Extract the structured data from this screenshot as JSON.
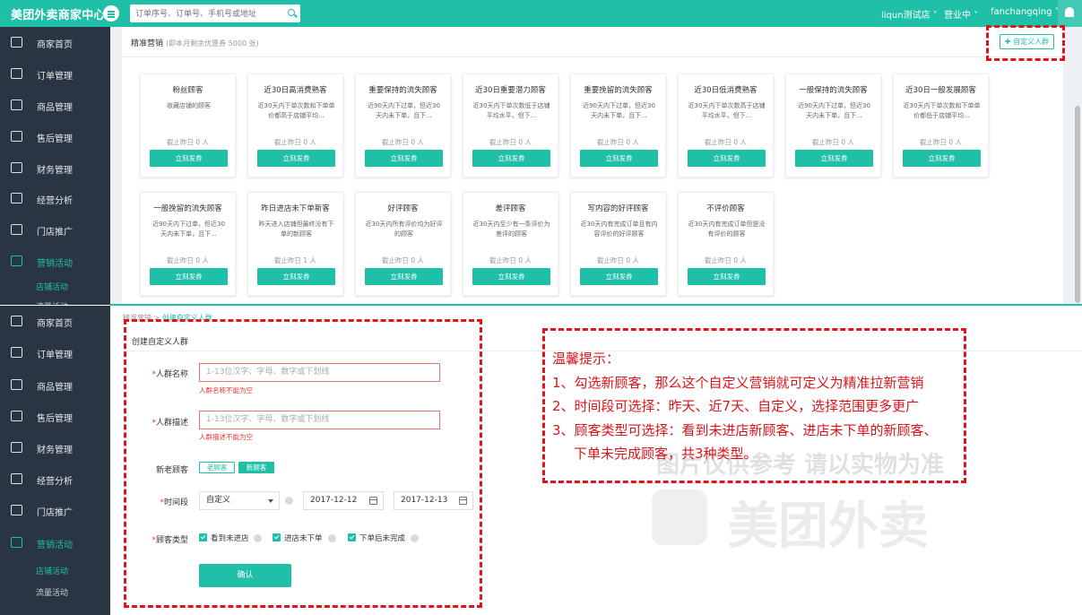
{
  "header": {
    "app_title": "美团外卖商家中心",
    "search_placeholder": "订单序号、订单号、手机号或地址",
    "store_name": "liqun测试店",
    "status": "营业中",
    "username": "fanchangqing",
    "accent_color": "#1fbfa8"
  },
  "sidebar": {
    "items": [
      {
        "label": "商家首页",
        "icon": "store-icon"
      },
      {
        "label": "订单管理",
        "icon": "order-icon"
      },
      {
        "label": "商品管理",
        "icon": "product-icon"
      },
      {
        "label": "售后管理",
        "icon": "after-sales-icon"
      },
      {
        "label": "财务管理",
        "icon": "finance-icon"
      },
      {
        "label": "经营分析",
        "icon": "chart-icon"
      },
      {
        "label": "门店推广",
        "icon": "promotion-icon"
      },
      {
        "label": "营销活动",
        "icon": "gift-icon"
      }
    ],
    "sub_items": [
      "店铺活动",
      "流量活动"
    ]
  },
  "upper": {
    "title": "精准营销",
    "subtitle": "(即本月剩余优惠券 5000 张)",
    "custom_button": "自定义人群",
    "cards": [
      {
        "title": "粉丝顾客",
        "desc": "收藏店铺的顾客",
        "count": "截止昨日 0 人",
        "button": "立刻发券"
      },
      {
        "title": "近30日高消费熟客",
        "desc": "近30天内下单次数和下单单价都高于店铺平均...",
        "count": "截止昨日 0 人",
        "button": "立刻发券"
      },
      {
        "title": "重要保持的流失顾客",
        "desc": "近90天内下过单，但近30天内未下单，且下...",
        "count": "截止昨日 0 人",
        "button": "立刻发券"
      },
      {
        "title": "近30日重要潜力顾客",
        "desc": "近30天内下单次数低于店铺平均水平，但下...",
        "count": "截止昨日 0 人",
        "button": "立刻发券"
      },
      {
        "title": "重要挽留的流失顾客",
        "desc": "近90天内下过单，但近30天内未下单，且下...",
        "count": "截止昨日 0 人",
        "button": "立刻发券"
      },
      {
        "title": "近30日低消费熟客",
        "desc": "近30天内下单次数高于店铺平均水平，但下...",
        "count": "截止昨日 0 人",
        "button": "立刻发券"
      },
      {
        "title": "一般保持的流失顾客",
        "desc": "近90天内下过单，但近30天内未下单，且下...",
        "count": "截止昨日 0 人",
        "button": "立刻发券"
      },
      {
        "title": "近30日一般发展顾客",
        "desc": "近30天内下单次数和下单单价都低于店铺平均...",
        "count": "截止昨日 0 人",
        "button": "立刻发券"
      },
      {
        "title": "一般挽留的流失顾客",
        "desc": "近90天内下过单，但近30天内未下单，且下...",
        "count": "截止昨日 0 人",
        "button": "立刻发券"
      },
      {
        "title": "昨日进店未下单新客",
        "desc": "昨天进入店铺但最终没有下单的新顾客",
        "count": "截止昨日 1 人",
        "button": "立刻发券"
      },
      {
        "title": "好评顾客",
        "desc": "近30天内所有评价均为好评的顾客",
        "count": "截止昨日 0 人",
        "button": "立刻发券"
      },
      {
        "title": "差评顾客",
        "desc": "近30天内至少有一条评价为差评的顾客",
        "count": "截止昨日 0 人",
        "button": "立刻发券"
      },
      {
        "title": "写内容的好评顾客",
        "desc": "近30天内有完成订单且有内容评价的好评顾客",
        "count": "截止昨日 0 人",
        "button": "立刻发券"
      },
      {
        "title": "不评价顾客",
        "desc": "近30天内有完成订单但是没有评价的顾客",
        "count": "截止昨日 0 人",
        "button": "立刻发券"
      }
    ]
  },
  "breadcrumb": {
    "parent": "精准营销",
    "sep": ">",
    "current": "创建自定义人群"
  },
  "form": {
    "title": "创建自定义人群",
    "name_label": "人群名称",
    "name_placeholder": "1-13位汉字、字母、数字或下划线",
    "name_error": "人群名称不能为空",
    "desc_label": "人群描述",
    "desc_placeholder": "1-13位汉字、字母、数字或下划线",
    "desc_error": "人群描述不能为空",
    "customer_label": "新老顾客",
    "tag_old": "老顾客",
    "tag_new": "新顾客",
    "period_label": "时间段",
    "period_value": "自定义",
    "start_date": "2017-12-12",
    "end_date": "2017-12-13",
    "type_label": "顾客类型",
    "types": [
      "看到未进店",
      "进店未下单",
      "下单后未完成"
    ],
    "confirm": "确认"
  },
  "tips": {
    "title": "温馨提示：",
    "line1": "1、勾选新顾客，那么这个自定义营销就可定义为精准拉新营销",
    "line2": "2、时间段可选择：昨天、近7天、自定义，选择范围更多更广",
    "line3": "3、顾客类型可选择：看到未进店新顾客、进店未下单的新顾客、",
    "line4": "下单未完成顾客，共3种类型。",
    "color": "#d9141b"
  },
  "watermark": {
    "notice": "图片仅供参考 请以实物为准",
    "brand": "美团外卖"
  }
}
